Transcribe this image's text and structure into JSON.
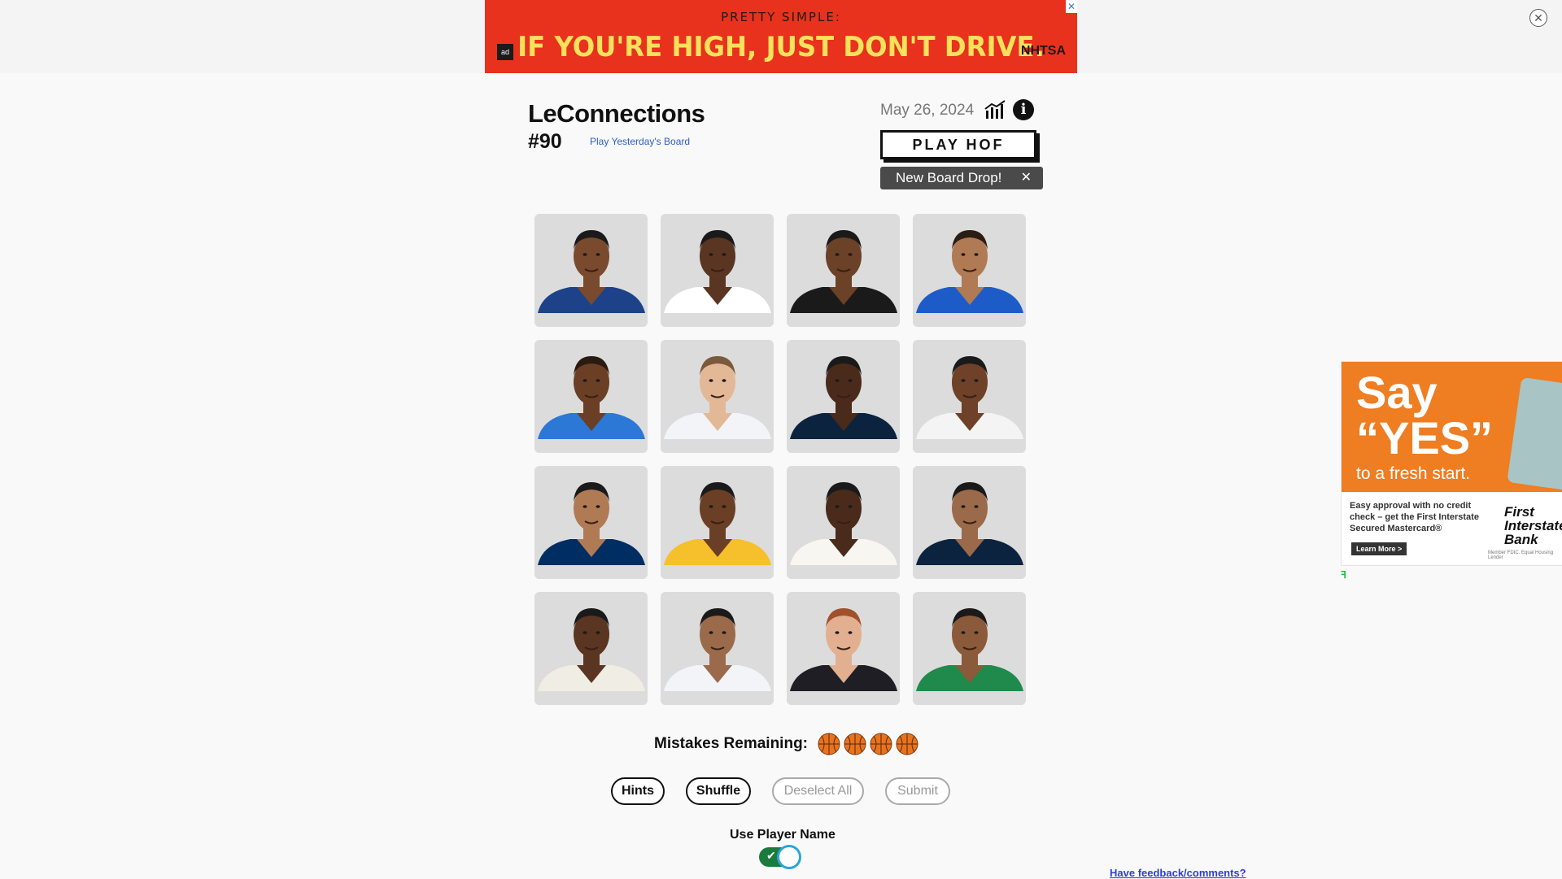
{
  "ads": {
    "top": {
      "line1": "PRETTY SIMPLE:",
      "line2": "IF YOU'RE HIGH, JUST DON'T DRIVE.",
      "badge": "ad",
      "brand": "NHTSA",
      "close": "✕"
    },
    "right": {
      "headline_1": "Say",
      "headline_2": "“YES”",
      "subline": "to a fresh start.",
      "body": "Easy approval with no credit check – get the First Interstate Secured Mastercard®",
      "cta": "Learn More >",
      "bank": "First Interstate Bank",
      "fine_print": "Member FDIC. Equal Housing Lender"
    }
  },
  "header": {
    "title": "LeConnections",
    "puzzle_number": "#90",
    "yesterday_link": "Play Yesterday's Board",
    "date": "May 26, 2024",
    "hof_button": "PLAY HOF",
    "new_board_badge": "New Board Drop!",
    "badge_close": "✕"
  },
  "tiles": [
    {
      "jersey": "#1d428a",
      "skin": "#7a4a2e",
      "hair": "#1a1a1a"
    },
    {
      "jersey": "#ffffff",
      "skin": "#5a3522",
      "hair": "#1a1a1a"
    },
    {
      "jersey": "#1a1a1a",
      "skin": "#6b4127",
      "hair": "#1a1a1a"
    },
    {
      "jersey": "#1d5cc8",
      "skin": "#b07a55",
      "hair": "#2a1d14"
    },
    {
      "jersey": "#2b78d6",
      "skin": "#6a3f25",
      "hair": "#2a1a10"
    },
    {
      "jersey": "#f2f4f8",
      "skin": "#e3b896",
      "hair": "#7a5a3a"
    },
    {
      "jersey": "#0c2340",
      "skin": "#4a2a1a",
      "hair": "#1a1a1a"
    },
    {
      "jersey": "#f4f4f4",
      "skin": "#6e4128",
      "hair": "#1a1a1a"
    },
    {
      "jersey": "#002d62",
      "skin": "#b07a55",
      "hair": "#1a1a1a"
    },
    {
      "jersey": "#f5c02c",
      "skin": "#6a3f25",
      "hair": "#1a1a1a"
    },
    {
      "jersey": "#f8f6f0",
      "skin": "#4a2a1a",
      "hair": "#1a1a1a"
    },
    {
      "jersey": "#0c2340",
      "skin": "#9a6a4a",
      "hair": "#1a1a1a"
    },
    {
      "jersey": "#f0ede4",
      "skin": "#5a3522",
      "hair": "#1a1a1a"
    },
    {
      "jersey": "#f2f4f8",
      "skin": "#9a6a4a",
      "hair": "#1a1a1a"
    },
    {
      "jersey": "#1e1e24",
      "skin": "#e2b090",
      "hair": "#a0502a"
    },
    {
      "jersey": "#1f8a4c",
      "skin": "#8a5a3a",
      "hair": "#1a1a1a"
    }
  ],
  "mistakes": {
    "label": "Mistakes Remaining:",
    "remaining": 4,
    "icon": "basketball-icon"
  },
  "actions": {
    "hints": "Hints",
    "shuffle": "Shuffle",
    "deselect": "Deselect All",
    "submit": "Submit"
  },
  "settings": {
    "player_name_label": "Use Player Name",
    "player_name_enabled": true
  },
  "footer": {
    "feedback_link": "Have feedback/comments?"
  },
  "colors": {
    "accent_link": "#2c5ec8",
    "toggle_on": "#1a7b3c",
    "ball": "#e8731f"
  }
}
